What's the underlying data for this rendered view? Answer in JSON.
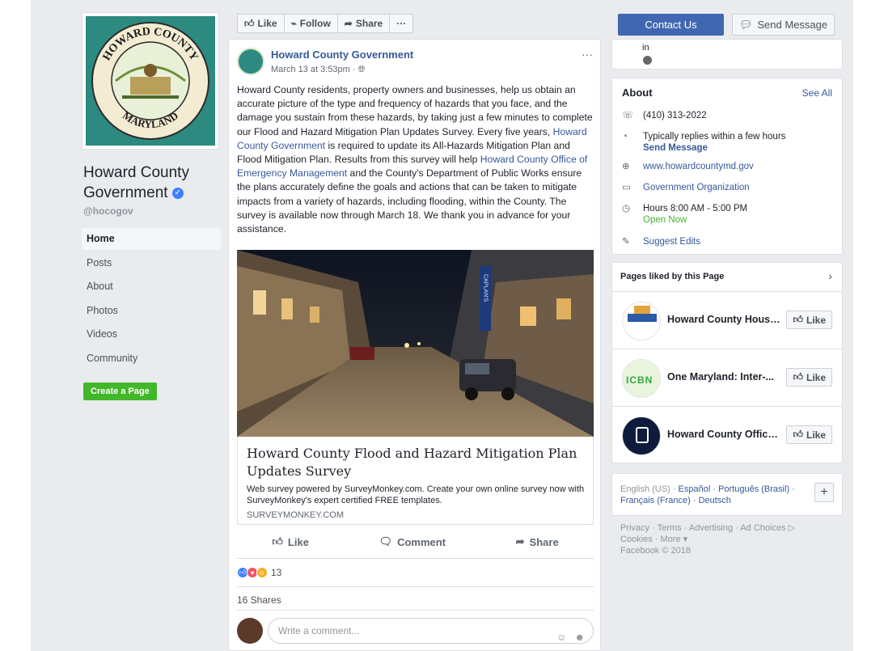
{
  "page": {
    "name": "Howard County Government",
    "handle": "@hocogov",
    "seal_top_text": "HOWARD COUNTY",
    "seal_bottom_text": "MARYLAND"
  },
  "nav": {
    "items": [
      {
        "label": "Home",
        "active": true
      },
      {
        "label": "Posts"
      },
      {
        "label": "About"
      },
      {
        "label": "Photos"
      },
      {
        "label": "Videos"
      },
      {
        "label": "Community"
      }
    ],
    "create_page": "Create a Page"
  },
  "actionbar": {
    "like": "Like",
    "follow": "Follow",
    "share": "Share",
    "more": "···"
  },
  "post": {
    "author": "Howard County Government",
    "meta": "March 13 at 3:53pm · ",
    "more": "···",
    "text_1": "Howard County residents, property owners and businesses, help us obtain an accurate picture of the type and frequency of hazards that you face, and the damage you sustain from these hazards, by taking just a few minutes to complete our Flood and Hazard Mitigation Plan Updates Survey. Every five years, ",
    "link_1": "Howard County Government",
    "text_2": " is required to update its All-Hazards Mitigation Plan and Flood Mitigation Plan. Results from this survey will help ",
    "link_2": "Howard County Office of Emergency Management",
    "text_3": " and the County's Department of Public Works ensure the plans accurately define the goals and actions that can be taken to mitigate impacts from a variety of hazards, including flooding, within the County. The survey is available now through March 18. We thank you in advance for your assistance.",
    "link_card": {
      "title": "Howard County Flood and Hazard Mitigation Plan Updates Survey",
      "description": "Web survey powered by SurveyMonkey.com. Create your own online survey now with SurveyMonkey's expert certified FREE templates.",
      "domain": "SURVEYMONKEY.COM"
    },
    "actions": {
      "like": "Like",
      "comment": "Comment",
      "share": "Share"
    },
    "reaction_count": "13",
    "shares": "16 Shares",
    "comment_placeholder": "Write a comment...",
    "sign_text": "CAPLAN'S"
  },
  "right": {
    "contact_us": "Contact Us",
    "send_message": "Send Message",
    "top_snippet": "in",
    "about": {
      "heading": "About",
      "see_all": "See All",
      "phone": "(410) 313-2022",
      "replies": "Typically replies within a few hours",
      "send_message_link": "Send Message",
      "website": "www.howardcountymd.gov",
      "category": "Government Organization",
      "hours": "Hours 8:00 AM - 5:00 PM",
      "open_now": "Open Now",
      "suggest_edits": "Suggest Edits"
    },
    "pages_liked": {
      "heading": "Pages liked by this Page",
      "items": [
        {
          "name": "Howard County Housi...",
          "like": "Like"
        },
        {
          "name": "One Maryland: Inter-...",
          "like": "Like"
        },
        {
          "name": "Howard County Office...",
          "like": "Like"
        }
      ]
    },
    "languages": {
      "current": "English (US)",
      "others": "Español · Português (Brasil) · Français (France) · Deutsch",
      "plus": "+"
    },
    "footer": {
      "line1": "Privacy · Terms · Advertising · Ad Choices ",
      "line2": "Cookies · More ▾",
      "line3": "Facebook © 2018"
    }
  },
  "colors": {
    "brand_blue": "#4267b2",
    "link": "#365899",
    "green": "#42b72a",
    "page_bg": "#e9ebee"
  }
}
